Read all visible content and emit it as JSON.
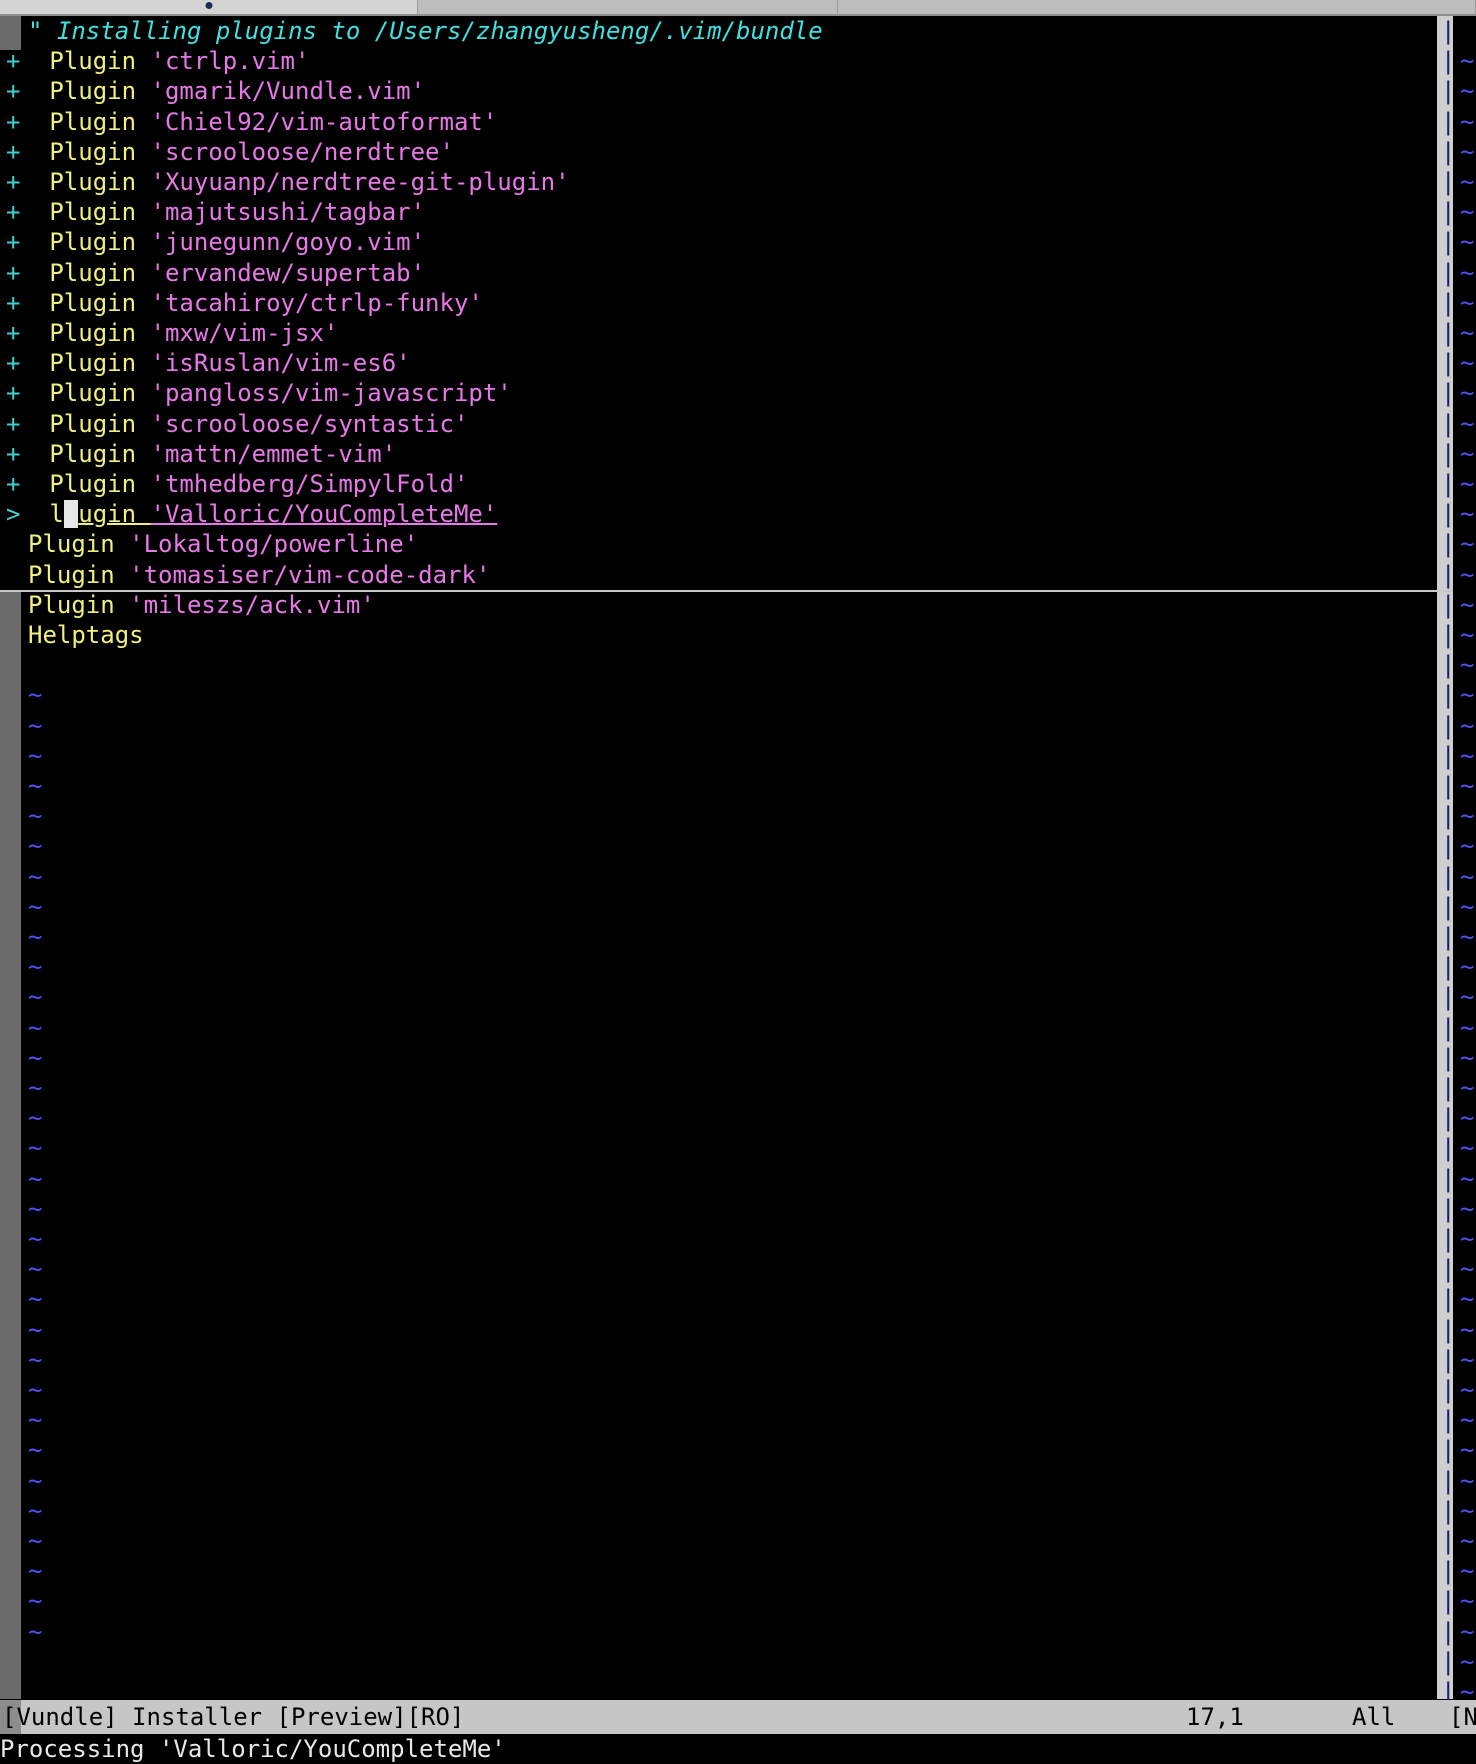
{
  "window": {
    "app": "MacVim",
    "colors": {
      "background": "#000000",
      "comment": "#40e0e0",
      "keyword": "#f0f080",
      "string": "#e878e8",
      "sign": "#40d0d0",
      "tilde": "#5050f8",
      "cursor": "#e8e8e8",
      "statusbar_bg": "#c6c6c6",
      "scrollbar": "#6b6b6b",
      "chrome": "#b8b8b8"
    }
  },
  "chrome": {
    "tabs": [
      {
        "name": "tab-1",
        "state": "active",
        "label": ""
      },
      {
        "name": "tab-2",
        "state": "inactive",
        "label": ""
      },
      {
        "name": "tab-3",
        "state": "inactive",
        "label": ""
      }
    ]
  },
  "buffer": {
    "name": "[Vundle] Installer",
    "header_text": "\" Installing plugins to /Users/zhangyusheng/.vim/bundle",
    "lines": [
      {
        "sign": "+",
        "keyword": "Plugin",
        "string": "'ctrlp.vim'"
      },
      {
        "sign": "+",
        "keyword": "Plugin",
        "string": "'gmarik/Vundle.vim'"
      },
      {
        "sign": "+",
        "keyword": "Plugin",
        "string": "'Chiel92/vim-autoformat'"
      },
      {
        "sign": "+",
        "keyword": "Plugin",
        "string": "'scrooloose/nerdtree'"
      },
      {
        "sign": "+",
        "keyword": "Plugin",
        "string": "'Xuyuanp/nerdtree-git-plugin'"
      },
      {
        "sign": "+",
        "keyword": "Plugin",
        "string": "'majutsushi/tagbar'"
      },
      {
        "sign": "+",
        "keyword": "Plugin",
        "string": "'junegunn/goyo.vim'"
      },
      {
        "sign": "+",
        "keyword": "Plugin",
        "string": "'ervandew/supertab'"
      },
      {
        "sign": "+",
        "keyword": "Plugin",
        "string": "'tacahiroy/ctrlp-funky'"
      },
      {
        "sign": "+",
        "keyword": "Plugin",
        "string": "'mxw/vim-jsx'"
      },
      {
        "sign": "+",
        "keyword": "Plugin",
        "string": "'isRuslan/vim-es6'"
      },
      {
        "sign": "+",
        "keyword": "Plugin",
        "string": "'pangloss/vim-javascript'"
      },
      {
        "sign": "+",
        "keyword": "Plugin",
        "string": "'scrooloose/syntastic'"
      },
      {
        "sign": "+",
        "keyword": "Plugin",
        "string": "'mattn/emmet-vim'"
      },
      {
        "sign": "+",
        "keyword": "Plugin",
        "string": "'tmhedberg/SimpylFold'"
      }
    ],
    "cursor_line": {
      "sign": ">",
      "prefix": "l",
      "cursor_char": "P",
      "keyword_rest": "ugin",
      "string": "'Valloric/YouCompleteMe'"
    },
    "pending_lines": [
      {
        "sign": " ",
        "keyword": "Plugin",
        "string": "'Lokaltog/powerline'"
      },
      {
        "sign": " ",
        "keyword": "Plugin",
        "string": "'tomasiser/vim-code-dark'"
      },
      {
        "sign": " ",
        "keyword": "Plugin",
        "string": "'mileszs/ack.vim'"
      }
    ],
    "footer_line": {
      "sign": " ",
      "keyword": "Helptags",
      "string": ""
    },
    "empty_marker": "~",
    "empty_marker_count": 32
  },
  "right_pane": {
    "empty_marker": "~",
    "bar_glyph": "|",
    "row_count": 56
  },
  "statusline": {
    "buffer_label": "[Vundle] Installer [Preview][RO]",
    "position": "17,1",
    "scroll_percent": "All",
    "next_window": "[N"
  },
  "cmdline": {
    "message": "Processing 'Valloric/YouCompleteMe'"
  }
}
